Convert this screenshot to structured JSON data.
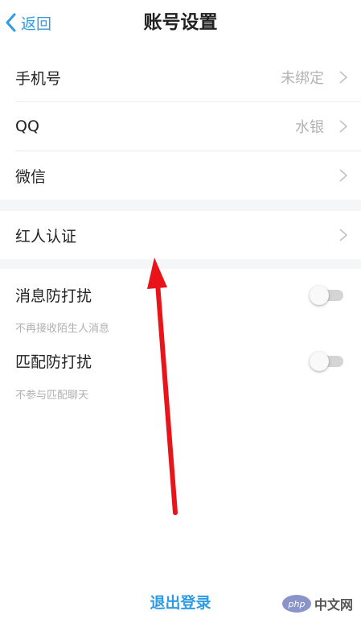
{
  "nav": {
    "back_label": "返回",
    "title": "账号设置"
  },
  "rows": {
    "phone": {
      "label": "手机号",
      "value": "未绑定"
    },
    "qq": {
      "label": "QQ",
      "value": "水银"
    },
    "wechat": {
      "label": "微信",
      "value": ""
    },
    "verify": {
      "label": "红人认证"
    }
  },
  "toggles": {
    "msg": {
      "label": "消息防打扰",
      "desc": "不再接收陌生人消息",
      "on": false
    },
    "match": {
      "label": "匹配防打扰",
      "desc": "不参与匹配聊天",
      "on": false
    }
  },
  "logout_label": "退出登录",
  "watermark": {
    "badge": "php",
    "text": "中文网"
  },
  "colors": {
    "accent": "#2f9be3",
    "annotation_arrow": "#e8141a"
  }
}
